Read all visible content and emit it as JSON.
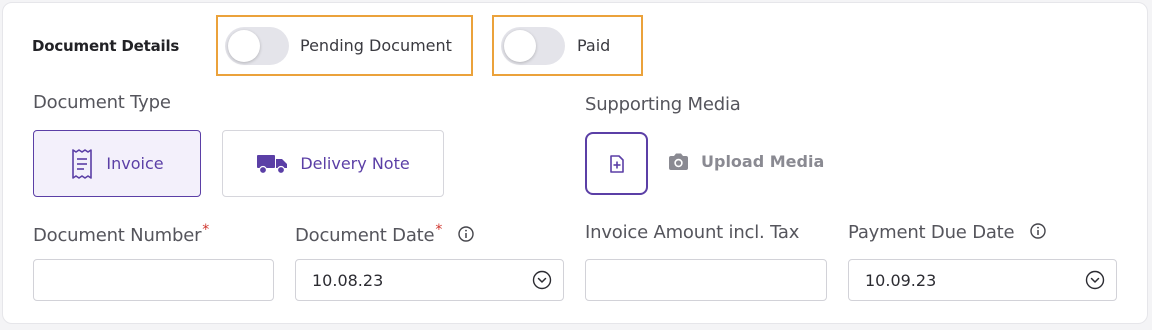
{
  "section": {
    "title": "Document Details"
  },
  "toggles": [
    {
      "label": "Pending Document",
      "checked": false
    },
    {
      "label": "Paid",
      "checked": false
    }
  ],
  "document_type": {
    "label": "Document Type",
    "options": [
      {
        "label": "Invoice",
        "icon": "receipt-icon",
        "selected": true
      },
      {
        "label": "Delivery Note",
        "icon": "truck-icon",
        "selected": false
      }
    ]
  },
  "supporting_media": {
    "label": "Supporting Media",
    "add_icon": "file-plus-icon",
    "upload_label": "Upload Media",
    "upload_icon": "camera-icon"
  },
  "fields": {
    "document_number": {
      "label": "Document Number",
      "required": "*",
      "value": ""
    },
    "document_date": {
      "label": "Document Date",
      "required": "*",
      "value": "10.08.23"
    },
    "invoice_amount": {
      "label": "Invoice Amount incl. Tax",
      "value": ""
    },
    "payment_due_date": {
      "label": "Payment Due Date",
      "value": "10.09.23"
    }
  },
  "colors": {
    "accent": "#5b3fa6",
    "highlight_outline": "#eba23b",
    "required": "#d0342c"
  }
}
